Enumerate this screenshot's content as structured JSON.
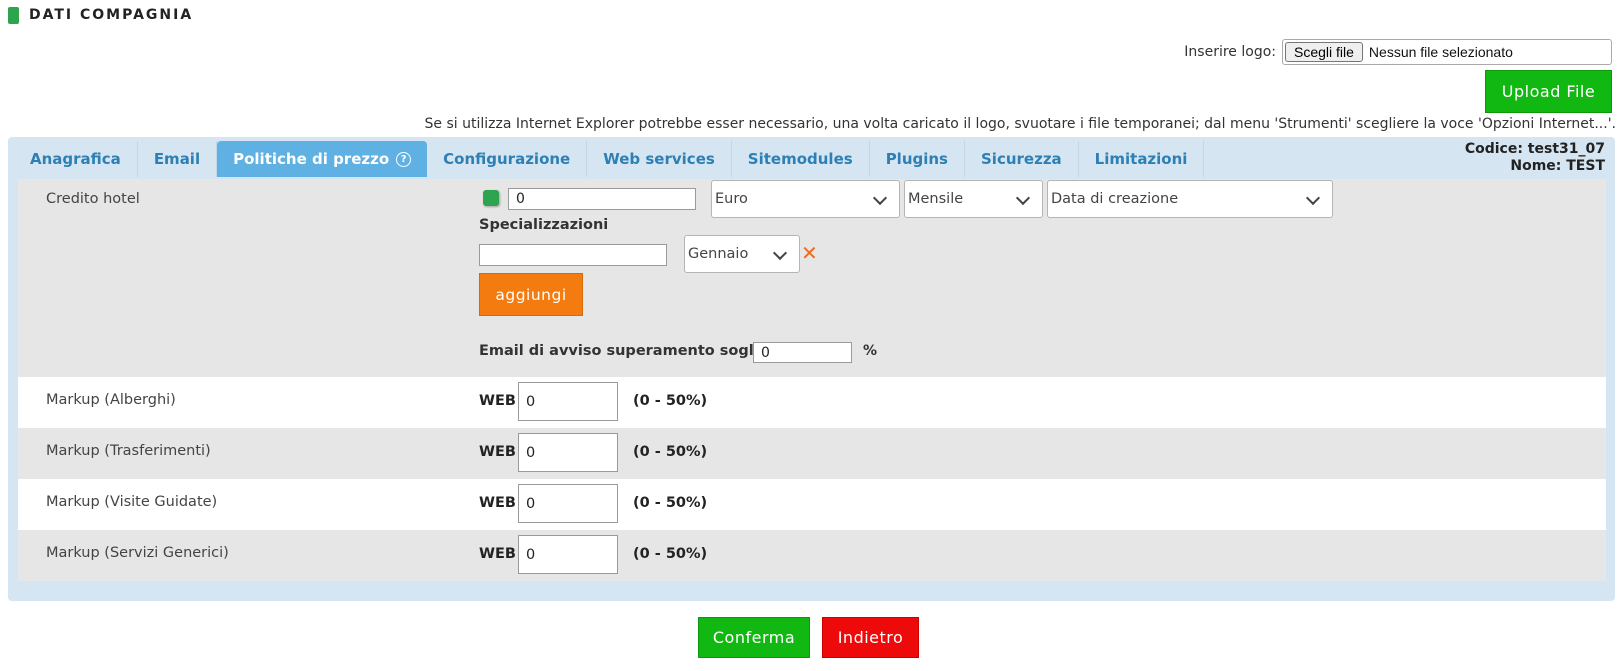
{
  "header": {
    "title": "DATI COMPAGNIA"
  },
  "logo": {
    "label": "Inserire logo:",
    "choose_button": "Scegli file",
    "file_status": "Nessun file selezionato",
    "upload_button": "Upload File",
    "ie_note": "Se si utilizza Internet Explorer potrebbe esser necessario, una volta caricato il logo, svuotare i file temporanei; dal menu 'Strumenti' scegliere la voce 'Opzioni Internet...'."
  },
  "tabs": [
    {
      "label": "Anagrafica"
    },
    {
      "label": "Email"
    },
    {
      "label": "Politiche di prezzo",
      "active": true
    },
    {
      "label": "Configurazione"
    },
    {
      "label": "Web services"
    },
    {
      "label": "Sitemodules"
    },
    {
      "label": "Plugins"
    },
    {
      "label": "Sicurezza"
    },
    {
      "label": "Limitazioni"
    }
  ],
  "info": {
    "codice": "Codice: test31_07",
    "nome": "Nome: TEST"
  },
  "credit": {
    "label": "Credito hotel",
    "amount": "0",
    "currency": "Euro",
    "period": "Mensile",
    "date_type": "Data di creazione",
    "spec_label": "Specializzazioni",
    "spec_value": "",
    "month": "Gennaio",
    "add_button": "aggiungi",
    "threshold_label": "Email di avviso superamento soglia a",
    "threshold_value": "0",
    "threshold_unit": "%"
  },
  "markups": [
    {
      "label": "Markup (Alberghi)",
      "channel": "WEB",
      "value": "0",
      "range": "(0 - 50%)"
    },
    {
      "label": "Markup (Trasferimenti)",
      "channel": "WEB",
      "value": "0",
      "range": "(0 - 50%)"
    },
    {
      "label": "Markup (Visite Guidate)",
      "channel": "WEB",
      "value": "0",
      "range": "(0 - 50%)"
    },
    {
      "label": "Markup (Servizi Generici)",
      "channel": "WEB",
      "value": "0",
      "range": "(0 - 50%)"
    }
  ],
  "actions": {
    "confirm": "Conferma",
    "back": "Indietro"
  },
  "colors": {
    "accent": "#5fb0e3",
    "confirm": "#12b812",
    "back": "#ee0a0a",
    "add": "#f47b10"
  }
}
